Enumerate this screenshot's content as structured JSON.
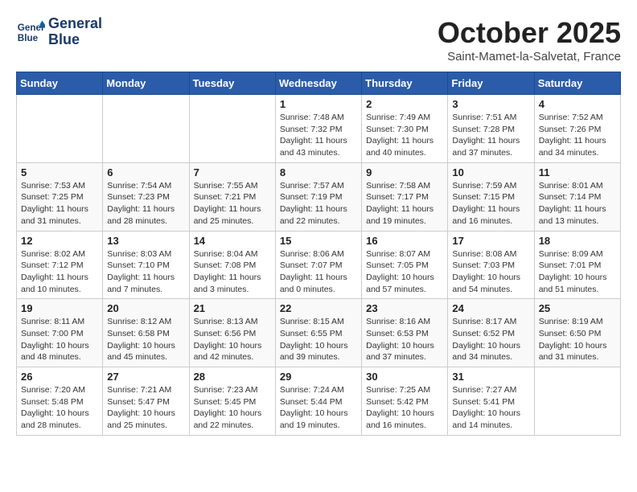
{
  "header": {
    "logo_line1": "General",
    "logo_line2": "Blue",
    "month": "October 2025",
    "location": "Saint-Mamet-la-Salvetat, France"
  },
  "weekdays": [
    "Sunday",
    "Monday",
    "Tuesday",
    "Wednesday",
    "Thursday",
    "Friday",
    "Saturday"
  ],
  "weeks": [
    [
      {
        "day": "",
        "info": ""
      },
      {
        "day": "",
        "info": ""
      },
      {
        "day": "",
        "info": ""
      },
      {
        "day": "1",
        "info": "Sunrise: 7:48 AM\nSunset: 7:32 PM\nDaylight: 11 hours and 43 minutes."
      },
      {
        "day": "2",
        "info": "Sunrise: 7:49 AM\nSunset: 7:30 PM\nDaylight: 11 hours and 40 minutes."
      },
      {
        "day": "3",
        "info": "Sunrise: 7:51 AM\nSunset: 7:28 PM\nDaylight: 11 hours and 37 minutes."
      },
      {
        "day": "4",
        "info": "Sunrise: 7:52 AM\nSunset: 7:26 PM\nDaylight: 11 hours and 34 minutes."
      }
    ],
    [
      {
        "day": "5",
        "info": "Sunrise: 7:53 AM\nSunset: 7:25 PM\nDaylight: 11 hours and 31 minutes."
      },
      {
        "day": "6",
        "info": "Sunrise: 7:54 AM\nSunset: 7:23 PM\nDaylight: 11 hours and 28 minutes."
      },
      {
        "day": "7",
        "info": "Sunrise: 7:55 AM\nSunset: 7:21 PM\nDaylight: 11 hours and 25 minutes."
      },
      {
        "day": "8",
        "info": "Sunrise: 7:57 AM\nSunset: 7:19 PM\nDaylight: 11 hours and 22 minutes."
      },
      {
        "day": "9",
        "info": "Sunrise: 7:58 AM\nSunset: 7:17 PM\nDaylight: 11 hours and 19 minutes."
      },
      {
        "day": "10",
        "info": "Sunrise: 7:59 AM\nSunset: 7:15 PM\nDaylight: 11 hours and 16 minutes."
      },
      {
        "day": "11",
        "info": "Sunrise: 8:01 AM\nSunset: 7:14 PM\nDaylight: 11 hours and 13 minutes."
      }
    ],
    [
      {
        "day": "12",
        "info": "Sunrise: 8:02 AM\nSunset: 7:12 PM\nDaylight: 11 hours and 10 minutes."
      },
      {
        "day": "13",
        "info": "Sunrise: 8:03 AM\nSunset: 7:10 PM\nDaylight: 11 hours and 7 minutes."
      },
      {
        "day": "14",
        "info": "Sunrise: 8:04 AM\nSunset: 7:08 PM\nDaylight: 11 hours and 3 minutes."
      },
      {
        "day": "15",
        "info": "Sunrise: 8:06 AM\nSunset: 7:07 PM\nDaylight: 11 hours and 0 minutes."
      },
      {
        "day": "16",
        "info": "Sunrise: 8:07 AM\nSunset: 7:05 PM\nDaylight: 10 hours and 57 minutes."
      },
      {
        "day": "17",
        "info": "Sunrise: 8:08 AM\nSunset: 7:03 PM\nDaylight: 10 hours and 54 minutes."
      },
      {
        "day": "18",
        "info": "Sunrise: 8:09 AM\nSunset: 7:01 PM\nDaylight: 10 hours and 51 minutes."
      }
    ],
    [
      {
        "day": "19",
        "info": "Sunrise: 8:11 AM\nSunset: 7:00 PM\nDaylight: 10 hours and 48 minutes."
      },
      {
        "day": "20",
        "info": "Sunrise: 8:12 AM\nSunset: 6:58 PM\nDaylight: 10 hours and 45 minutes."
      },
      {
        "day": "21",
        "info": "Sunrise: 8:13 AM\nSunset: 6:56 PM\nDaylight: 10 hours and 42 minutes."
      },
      {
        "day": "22",
        "info": "Sunrise: 8:15 AM\nSunset: 6:55 PM\nDaylight: 10 hours and 39 minutes."
      },
      {
        "day": "23",
        "info": "Sunrise: 8:16 AM\nSunset: 6:53 PM\nDaylight: 10 hours and 37 minutes."
      },
      {
        "day": "24",
        "info": "Sunrise: 8:17 AM\nSunset: 6:52 PM\nDaylight: 10 hours and 34 minutes."
      },
      {
        "day": "25",
        "info": "Sunrise: 8:19 AM\nSunset: 6:50 PM\nDaylight: 10 hours and 31 minutes."
      }
    ],
    [
      {
        "day": "26",
        "info": "Sunrise: 7:20 AM\nSunset: 5:48 PM\nDaylight: 10 hours and 28 minutes."
      },
      {
        "day": "27",
        "info": "Sunrise: 7:21 AM\nSunset: 5:47 PM\nDaylight: 10 hours and 25 minutes."
      },
      {
        "day": "28",
        "info": "Sunrise: 7:23 AM\nSunset: 5:45 PM\nDaylight: 10 hours and 22 minutes."
      },
      {
        "day": "29",
        "info": "Sunrise: 7:24 AM\nSunset: 5:44 PM\nDaylight: 10 hours and 19 minutes."
      },
      {
        "day": "30",
        "info": "Sunrise: 7:25 AM\nSunset: 5:42 PM\nDaylight: 10 hours and 16 minutes."
      },
      {
        "day": "31",
        "info": "Sunrise: 7:27 AM\nSunset: 5:41 PM\nDaylight: 10 hours and 14 minutes."
      },
      {
        "day": "",
        "info": ""
      }
    ]
  ]
}
